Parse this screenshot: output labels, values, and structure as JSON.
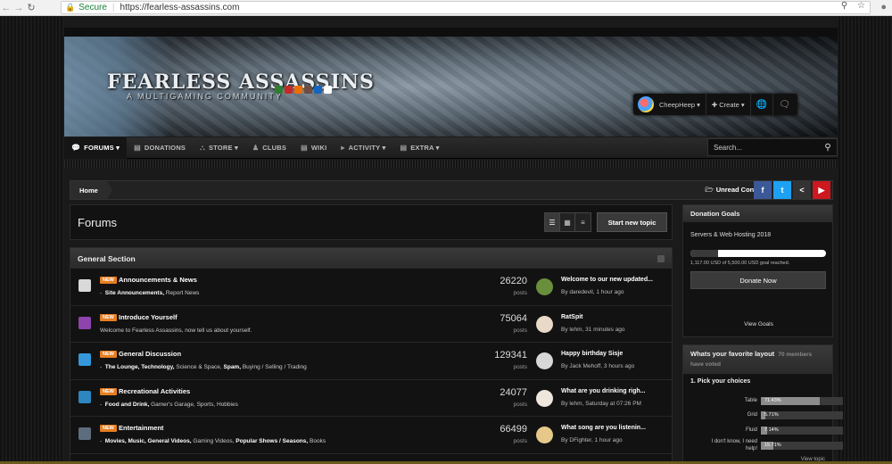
{
  "browser": {
    "secure_label": "Secure",
    "url": "https://fearless-assassins.com"
  },
  "banner": {
    "logo_title": "FEARLESS ASSASSINS",
    "logo_subtitle": "A MULTIGAMING COMMUNITY"
  },
  "userbar": {
    "username": "CheepHeep ▾",
    "create": "✚ Create ▾"
  },
  "nav": {
    "items": [
      {
        "label": "FORUMS ▾",
        "icon": "comments-icon"
      },
      {
        "label": "DONATIONS",
        "icon": "document-icon"
      },
      {
        "label": "STORE ▾",
        "icon": "cart-icon"
      },
      {
        "label": "CLUBS",
        "icon": "users-icon"
      },
      {
        "label": "WIKI",
        "icon": "file-icon"
      },
      {
        "label": "ACTIVITY ▾",
        "icon": "bullhorn-icon"
      },
      {
        "label": "EXTRA ▾",
        "icon": "file-icon"
      }
    ],
    "search_placeholder": "Search..."
  },
  "breadcrumb": {
    "home": "Home",
    "unread": "Unread Content"
  },
  "forums": {
    "title": "Forums",
    "new_topic": "Start new topic",
    "section_title": "General Section",
    "badge": "NEW",
    "posts_label": "posts",
    "rows": [
      {
        "name": "Announcements & News",
        "sub_prefix": "-",
        "sub": [
          {
            "text": "Site Announcements,",
            "bold": true
          },
          {
            "text": "Report News",
            "bold": false
          }
        ],
        "count": "26220",
        "last_title": "Welcome to our new updated...",
        "last_by": "By daredevil, 1 hour ago"
      },
      {
        "name": "Introduce Yourself",
        "sub_prefix": "",
        "sub": [
          {
            "text": "Welcome to Fearless Assassins, now tell us about yourself.",
            "bold": false
          }
        ],
        "count": "75064",
        "last_title": "RatSpit",
        "last_by": "By lehm, 31 minutes ago"
      },
      {
        "name": "General Discussion",
        "sub_prefix": "-",
        "sub": [
          {
            "text": "The Lounge,",
            "bold": true
          },
          {
            "text": "Technology,",
            "bold": true
          },
          {
            "text": "Science & Space,",
            "bold": false
          },
          {
            "text": "Spam,",
            "bold": true
          },
          {
            "text": "Buying / Selling / Trading",
            "bold": false
          }
        ],
        "count": "129341",
        "last_title": "Happy birthday Sisje",
        "last_by": "By Jack Mehoff, 3 hours ago"
      },
      {
        "name": "Recreational Activities",
        "sub_prefix": "-",
        "sub": [
          {
            "text": "Food and Drink,",
            "bold": true
          },
          {
            "text": "Gamer's Garage,",
            "bold": false
          },
          {
            "text": "Sports,",
            "bold": false
          },
          {
            "text": "Hobbies",
            "bold": false
          }
        ],
        "count": "24077",
        "last_title": "What are you drinking righ...",
        "last_by": "By lehm, Saturday at 07:26 PM"
      },
      {
        "name": "Entertainment",
        "sub_prefix": "-",
        "sub": [
          {
            "text": "Movies,",
            "bold": true
          },
          {
            "text": "Music,",
            "bold": true
          },
          {
            "text": "General Videos,",
            "bold": true
          },
          {
            "text": "Gaming Videos,",
            "bold": false
          },
          {
            "text": "Popular Shows / Seasons,",
            "bold": true
          },
          {
            "text": "Books",
            "bold": false
          }
        ],
        "count": "66499",
        "last_title": "What song are you listenin...",
        "last_by": "By DFighter, 1 hour ago"
      }
    ]
  },
  "donation": {
    "title": "Donation Goals",
    "goal_name": "Servers & Web Hosting 2018",
    "progress_fraction": 0.2031,
    "reached_text": "1,117.00 USD of 5,500.00 USD goal reached.",
    "donate_label": "Donate Now",
    "view_goals": "View Goals"
  },
  "poll": {
    "title": "Whats your favorite layout",
    "members": "70 members have voted",
    "question": "1. Pick your choices",
    "choices": [
      {
        "label": "Table",
        "percent": 71.43,
        "text": "71.43%"
      },
      {
        "label": "Grid",
        "percent": 5.71,
        "text": "5.71%"
      },
      {
        "label": "Fluid",
        "percent": 7.14,
        "text": "7.14%"
      },
      {
        "label": "I don't know, I need help!",
        "percent": 15.71,
        "text": "15.71%"
      }
    ],
    "view_topic": "View topic"
  }
}
